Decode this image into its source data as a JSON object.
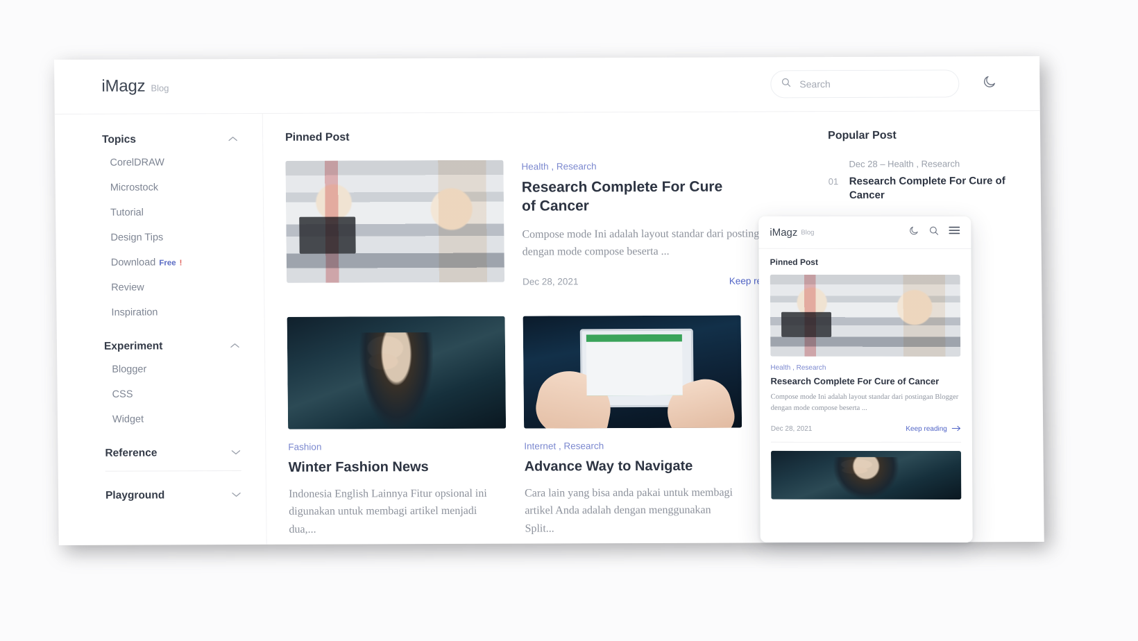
{
  "header": {
    "brand_name": "iMagz",
    "brand_sub": "Blog",
    "search_placeholder": "Search",
    "dark_mode_icon": "moon-icon",
    "search_icon": "search-icon"
  },
  "sidebar": {
    "sections": [
      {
        "title": "Topics",
        "chevron": "chevron-up-icon",
        "items": [
          {
            "label": "CorelDRAW"
          },
          {
            "label": "Microstock"
          },
          {
            "label": "Tutorial"
          },
          {
            "label": "Design Tips"
          },
          {
            "label": "Download",
            "tag": "Free",
            "tag_bang": "!"
          },
          {
            "label": "Review"
          },
          {
            "label": "Inspiration"
          }
        ]
      },
      {
        "title": "Experiment",
        "chevron": "chevron-up-icon",
        "items": [
          {
            "label": "Blogger"
          },
          {
            "label": "CSS"
          },
          {
            "label": "Widget"
          }
        ]
      },
      {
        "title": "Reference",
        "chevron": "chevron-down-icon",
        "items": []
      },
      {
        "title": "Playground",
        "chevron": "chevron-down-icon",
        "items": []
      }
    ]
  },
  "main": {
    "pinned_heading": "Pinned Post",
    "pinned": {
      "categories": "Health , Research",
      "title": "Research Complete For Cure of Cancer",
      "excerpt": "Compose mode Ini adalah layout standar dari postingan Blogger dengan mode compose beserta ...",
      "date": "Dec 28, 2021",
      "keep_reading": "Keep reading",
      "thumb": "laboratory-photo"
    },
    "cards": [
      {
        "categories": "Fashion",
        "title": "Winter Fashion News",
        "excerpt": "Indonesia English Lainnya Fitur opsional ini digunakan untuk membagi artikel menjadi dua,...",
        "thumb": "winter-portrait-photo"
      },
      {
        "categories": "Internet , Research",
        "title": "Advance Way to Navigate",
        "excerpt": "Cara lain yang bisa anda pakai untuk membagi artikel Anda adalah dengan menggunakan Split...",
        "thumb": "tablet-map-photo"
      }
    ]
  },
  "rail": {
    "heading": "Popular Post",
    "items": [
      {
        "number": "01",
        "meta": "Dec 28  –  Health , Research",
        "title": "Research Complete For Cure of Cancer"
      }
    ]
  },
  "mobile": {
    "brand_name": "iMagz",
    "brand_sub": "Blog",
    "icons": [
      "moon-icon",
      "search-icon",
      "hamburger-icon"
    ],
    "pinned_heading": "Pinned Post",
    "post": {
      "categories": "Health , Research",
      "title": "Research Complete For Cure of Cancer",
      "excerpt": "Compose mode Ini adalah layout standar dari postingan Blogger dengan mode compose beserta ...",
      "date": "Dec 28, 2021",
      "keep_reading": "Keep reading",
      "thumb": "laboratory-photo"
    },
    "next_thumb": "winter-portrait-photo"
  },
  "colors": {
    "accent": "#4f63c6",
    "category": "#7b88cf",
    "heading": "#2d3442",
    "muted": "#9aa0ab",
    "free_tag": "#5b6cc4"
  }
}
